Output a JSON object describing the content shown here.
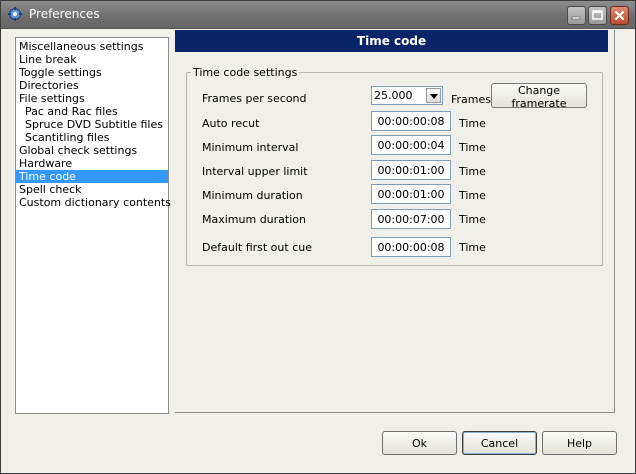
{
  "window": {
    "title": "Preferences"
  },
  "tree": {
    "items": [
      {
        "label": "Miscellaneous settings",
        "child": false,
        "selected": false
      },
      {
        "label": "Line break",
        "child": false,
        "selected": false
      },
      {
        "label": "Toggle settings",
        "child": false,
        "selected": false
      },
      {
        "label": "Directories",
        "child": false,
        "selected": false
      },
      {
        "label": "File settings",
        "child": false,
        "selected": false
      },
      {
        "label": "Pac and Rac files",
        "child": true,
        "selected": false
      },
      {
        "label": "Spruce DVD Subtitle files",
        "child": true,
        "selected": false
      },
      {
        "label": "Scantitling files",
        "child": true,
        "selected": false
      },
      {
        "label": "Global check settings",
        "child": false,
        "selected": false
      },
      {
        "label": "Hardware",
        "child": false,
        "selected": false
      },
      {
        "label": "Time code",
        "child": false,
        "selected": true
      },
      {
        "label": "Spell check",
        "child": false,
        "selected": false
      },
      {
        "label": "Custom dictionary contents",
        "child": false,
        "selected": false
      }
    ]
  },
  "panel": {
    "title": "Time code",
    "group_title": "Time code settings",
    "fps": {
      "label": "Frames per second",
      "value": "25.000",
      "unit": "Frames",
      "change_button": "Change framerate"
    },
    "fields": [
      {
        "label": "Auto recut",
        "value": "00:00:00:08",
        "unit": "Time"
      },
      {
        "label": "Minimum interval",
        "value": "00:00:00:04",
        "unit": "Time"
      },
      {
        "label": "Interval upper limit",
        "value": "00:00:01:00",
        "unit": "Time"
      },
      {
        "label": "Minimum duration",
        "value": "00:00:01:00",
        "unit": "Time"
      },
      {
        "label": "Maximum duration",
        "value": "00:00:07:00",
        "unit": "Time"
      },
      {
        "label": "Default first out cue",
        "value": "00:00:00:08",
        "unit": "Time"
      }
    ]
  },
  "buttons": {
    "ok": "Ok",
    "cancel": "Cancel",
    "help": "Help"
  },
  "colors": {
    "header_bg": "#0a246a",
    "selection_bg": "#3399ff",
    "dialog_bg": "#f0efe9"
  }
}
